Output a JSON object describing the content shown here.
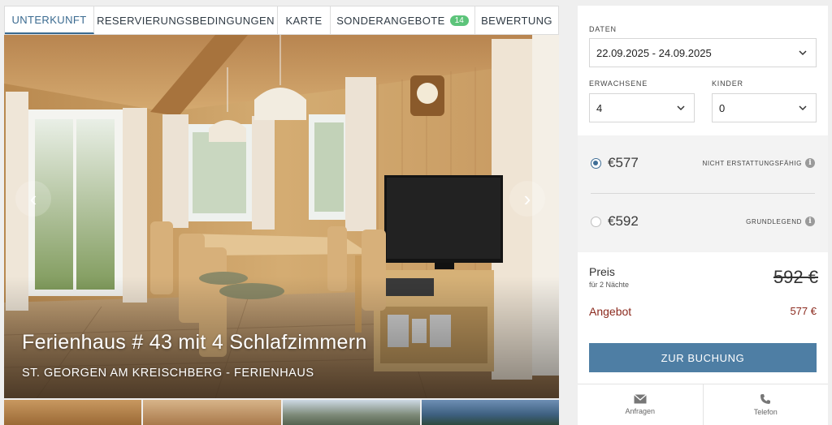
{
  "tabs": [
    {
      "label": "UNTERKUNFT",
      "active": true
    },
    {
      "label": "RESERVIERUNGSBEDINGUNGEN"
    },
    {
      "label": "KARTE"
    },
    {
      "label": "SONDERANGEBOTE",
      "badge": "14"
    },
    {
      "label": "BEWERTUNG"
    }
  ],
  "hero": {
    "title": "Ferienhaus # 43 mit 4 Schlafzimmern",
    "subtitle": "ST. GEORGEN AM KREISCHBERG - FERIENHAUS",
    "prev_icon": "chevron-left-icon",
    "next_icon": "chevron-right-icon"
  },
  "booking": {
    "dates_label": "DATEN",
    "dates_value": "22.09.2025 - 24.09.2025",
    "adults_label": "ERWACHSENE",
    "adults_value": "4",
    "children_label": "KINDER",
    "children_value": "0",
    "rates": [
      {
        "price": "€577",
        "name": "NICHT ERSTATTUNGSFÄHIG",
        "selected": true
      },
      {
        "price": "€592",
        "name": "GRUNDLEGEND",
        "selected": false
      }
    ],
    "price_label": "Preis",
    "nights_label": "für 2 Nächte",
    "old_price": "592 €",
    "offer_label": "Angebot",
    "offer_price": "577 €",
    "cta_label": "ZUR BUCHUNG",
    "inquiry_label": "Anfragen",
    "phone_label": "Telefon"
  },
  "colors": {
    "accent": "#4e7ea4",
    "offer": "#8b2a1e",
    "badge": "#5cc47a"
  }
}
